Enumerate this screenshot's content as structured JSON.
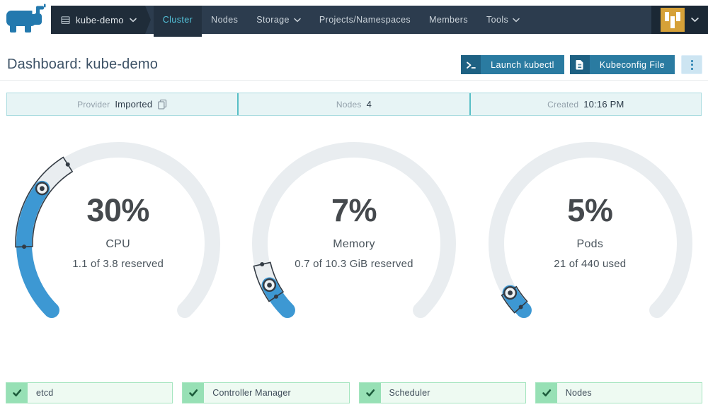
{
  "nav": {
    "cluster": {
      "label": "kube-demo"
    },
    "items": [
      {
        "label": "Cluster",
        "active": true
      },
      {
        "label": "Nodes"
      },
      {
        "label": "Storage",
        "chevron": true
      },
      {
        "label": "Projects/Namespaces"
      },
      {
        "label": "Members"
      },
      {
        "label": "Tools",
        "chevron": true
      }
    ]
  },
  "header": {
    "title": "Dashboard: kube-demo",
    "actions": {
      "launch_kubectl": "Launch kubectl",
      "kubeconfig_file": "Kubeconfig File"
    }
  },
  "info_bar": {
    "items": [
      {
        "label": "Provider",
        "value": "Imported"
      },
      {
        "label": "Nodes",
        "value": "4"
      },
      {
        "label": "Created",
        "value": "10:16 PM"
      }
    ]
  },
  "chart_data": [
    {
      "type": "gauge",
      "title": "CPU",
      "display": "30%",
      "percent": 30,
      "subtitle": "1.1 of 3.8 reserved",
      "min": 0,
      "max": 100,
      "range_low": 16,
      "range_high": 38,
      "marker": 30
    },
    {
      "type": "gauge",
      "title": "Memory",
      "display": "7%",
      "percent": 7,
      "subtitle": "0.7 of 10.3 GiB reserved",
      "min": 0,
      "max": 100,
      "range_low": 4,
      "range_high": 12,
      "marker": 7
    },
    {
      "type": "gauge",
      "title": "Pods",
      "display": "5%",
      "percent": 5,
      "subtitle": "21 of 440 used",
      "min": 0,
      "max": 100,
      "range_low": 1,
      "range_high": 5.5,
      "marker": 5
    }
  ],
  "status_bars": {
    "items": [
      "etcd",
      "Controller Manager",
      "Scheduler",
      "Nodes"
    ]
  },
  "colors": {
    "nav_bg": "#2c3c4e",
    "nav_selector_bg": "#1f2c39",
    "nav_active_text": "#54c3da",
    "button_teal": "#2a7ba1",
    "button_icon_teal": "#1e6183",
    "info_bg": "#e7f4f5",
    "gauge_fill": "#3d98d3",
    "gauge_track": "#e9edf0",
    "gauge_outline": "#333b44",
    "status_green": "#97e0b5",
    "status_check": "#1d5c3c",
    "avatar_gold": "#d6a138"
  }
}
